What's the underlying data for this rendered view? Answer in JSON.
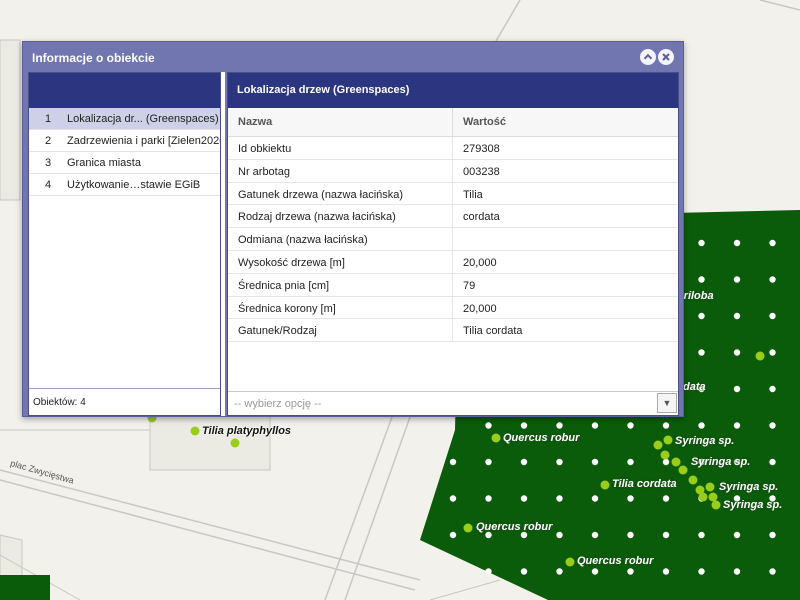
{
  "dialog": {
    "title": "Informacje o obiekcie",
    "collapse_icon": "chevron-up-icon",
    "close_icon": "close-icon"
  },
  "objects": {
    "items": [
      {
        "num": "1",
        "name": "Lokalizacja dr... (Greenspaces)",
        "selected": true
      },
      {
        "num": "2",
        "name": "Zadrzewienia i parki [Zielen2020]",
        "selected": false
      },
      {
        "num": "3",
        "name": "Granica miasta",
        "selected": false
      },
      {
        "num": "4",
        "name": "Użytkowanie…stawie EGiB",
        "selected": false
      }
    ],
    "count_label": "Obiektów: 4"
  },
  "details": {
    "title": "Lokalizacja drzew (Greenspaces)",
    "col_name": "Nazwa",
    "col_value": "Wartość",
    "rows": [
      {
        "name": "Id obkiektu",
        "value": "279308"
      },
      {
        "name": "Nr arbotag",
        "value": "003238"
      },
      {
        "name": "Gatunek drzewa (nazwa łacińska)",
        "value": "Tilia"
      },
      {
        "name": "Rodzaj drzewa (nazwa łacińska)",
        "value": "cordata"
      },
      {
        "name": "Odmiana (nazwa łacińska)",
        "value": ""
      },
      {
        "name": "Wysokość drzewa [m]",
        "value": "20,000"
      },
      {
        "name": "Średnica pnia [cm]",
        "value": "79"
      },
      {
        "name": "Średnica korony [m]",
        "value": "20,000"
      },
      {
        "name": "Gatunek/Rodzaj",
        "value": "Tilia cordata"
      }
    ],
    "select_placeholder": "-- wybierz opcję --"
  },
  "map": {
    "street_name": "plac Zwycięstwa",
    "labels": {
      "tilia_platyphyllos": "Tilia platyphyllos",
      "quercus_robur_1": "Quercus robur",
      "quercus_robur_2": "Quercus robur",
      "quercus_robur_3": "Quercus robur",
      "syringa_1": "Syringa sp.",
      "syringa_2": "Syringa sp.",
      "syringa_3": "Syringa sp.",
      "syringa_4": "Syringa sp.",
      "tilia_cordata": "Tilia cordata",
      "triloba": "triloba",
      "cordata_partial": "data"
    },
    "colors": {
      "background": "#f2f1ec",
      "park": "#0a5c0a",
      "tree_point": "#9acd1a",
      "grid_dot": "#ffffff",
      "road_stroke": "#c7c7c7",
      "block_fill": "#ebebe4"
    }
  }
}
